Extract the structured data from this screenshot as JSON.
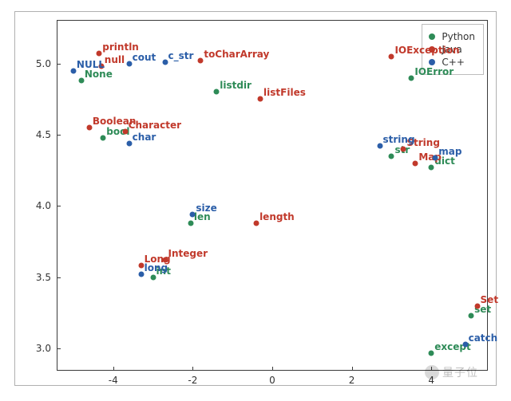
{
  "chart_data": {
    "type": "scatter",
    "xlabel": "",
    "ylabel": "",
    "xlim": [
      -5.4,
      5.4
    ],
    "ylim": [
      2.85,
      5.3
    ],
    "xticks": [
      -4,
      -2,
      0,
      2,
      4
    ],
    "yticks": [
      3.0,
      3.5,
      4.0,
      4.5,
      5.0
    ],
    "legend_position": "upper right",
    "series": [
      {
        "name": "Python",
        "color": "#2e8b57",
        "points": [
          {
            "x": -4.8,
            "y": 4.88,
            "label": "None"
          },
          {
            "x": -4.25,
            "y": 4.48,
            "label": "bool"
          },
          {
            "x": -2.05,
            "y": 3.88,
            "label": "len"
          },
          {
            "x": 3.0,
            "y": 4.35,
            "label": "str"
          },
          {
            "x": 4.0,
            "y": 4.27,
            "label": "dict"
          },
          {
            "x": 4.0,
            "y": 2.97,
            "label": "except"
          },
          {
            "x": 5.0,
            "y": 3.23,
            "label": "set"
          },
          {
            "x": -3.0,
            "y": 3.5,
            "label": "int"
          },
          {
            "x": -1.4,
            "y": 4.8,
            "label": "listdir"
          },
          {
            "x": 3.5,
            "y": 4.9,
            "label": "IOError"
          }
        ]
      },
      {
        "name": "Java",
        "color": "#c1392b",
        "points": [
          {
            "x": -4.35,
            "y": 5.07,
            "label": "println"
          },
          {
            "x": -4.3,
            "y": 4.98,
            "label": "null"
          },
          {
            "x": -4.6,
            "y": 4.55,
            "label": "Boolean"
          },
          {
            "x": -3.7,
            "y": 4.52,
            "label": "Character"
          },
          {
            "x": -1.8,
            "y": 5.02,
            "label": "toCharArray"
          },
          {
            "x": -2.7,
            "y": 3.62,
            "label": "Integer"
          },
          {
            "x": -3.3,
            "y": 3.58,
            "label": "Long"
          },
          {
            "x": -0.4,
            "y": 3.88,
            "label": "length"
          },
          {
            "x": -0.3,
            "y": 4.75,
            "label": "listFiles"
          },
          {
            "x": 3.3,
            "y": 4.4,
            "label": "String"
          },
          {
            "x": 3.6,
            "y": 4.3,
            "label": "Map"
          },
          {
            "x": 3.0,
            "y": 5.05,
            "label": "IOException"
          },
          {
            "x": 5.15,
            "y": 3.3,
            "label": "Set"
          }
        ]
      },
      {
        "name": "C++",
        "color": "#2b5ea8",
        "points": [
          {
            "x": -5.0,
            "y": 4.95,
            "label": "NULL"
          },
          {
            "x": -3.6,
            "y": 5.0,
            "label": "cout"
          },
          {
            "x": -2.7,
            "y": 5.01,
            "label": "c_str"
          },
          {
            "x": -3.6,
            "y": 4.44,
            "label": "char"
          },
          {
            "x": -3.3,
            "y": 3.52,
            "label": "long"
          },
          {
            "x": -2.0,
            "y": 3.94,
            "label": "size"
          },
          {
            "x": 2.7,
            "y": 4.42,
            "label": "string"
          },
          {
            "x": 4.1,
            "y": 4.34,
            "label": "map"
          },
          {
            "x": 4.85,
            "y": 3.03,
            "label": "catch"
          }
        ]
      }
    ]
  },
  "watermark": "量子位"
}
